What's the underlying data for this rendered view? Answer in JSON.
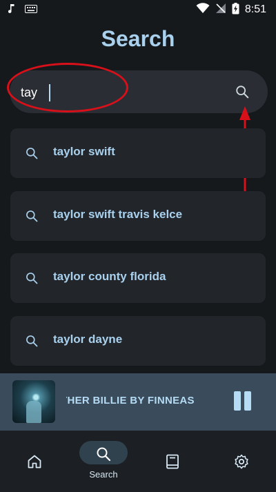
{
  "status_bar": {
    "time": "8:51"
  },
  "page": {
    "title": "Search"
  },
  "search": {
    "value": "tay",
    "icon": "search-icon"
  },
  "suggestions": [
    {
      "label": "taylor swift"
    },
    {
      "label": "taylor swift travis kelce"
    },
    {
      "label": "taylor county florida"
    },
    {
      "label": "taylor dayne"
    }
  ],
  "now_playing": {
    "title": "THER BILLIE BY FINNEAS",
    "state": "playing"
  },
  "bottom_nav": {
    "items": [
      {
        "icon": "home-icon",
        "label": ""
      },
      {
        "icon": "search-icon",
        "label": "Search",
        "active": true
      },
      {
        "icon": "library-icon",
        "label": ""
      },
      {
        "icon": "settings-icon",
        "label": ""
      }
    ]
  },
  "colors": {
    "background": "#16191c",
    "accent": "#a9d1ee",
    "annotation": "#d8101a",
    "now_playing_bg": "#3a4b5c"
  }
}
